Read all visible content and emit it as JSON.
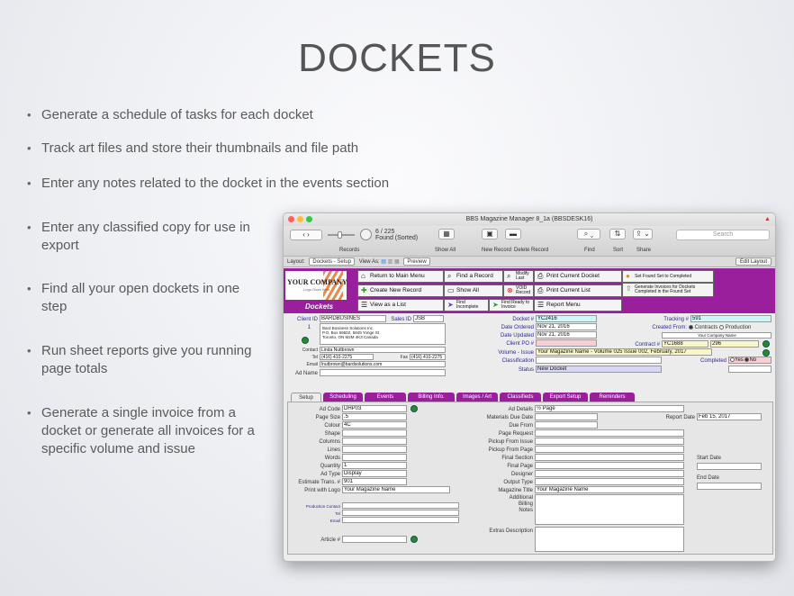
{
  "slide": {
    "title": "DOCKETS",
    "bullets": [
      "Generate a schedule of tasks for each docket",
      "Track art files and store their thumbnails and file path",
      "Enter any notes related to the docket in the events section",
      "Enter any classified copy for use in export",
      "Find all your open dockets in one step",
      "Run sheet reports give you running page totals",
      "Generate a single invoice from a docket or generate all invoices for a specific volume and issue"
    ]
  },
  "window": {
    "title": "BBS  Magazine Manager 8_1a (BBSDESK16)",
    "toolbar": {
      "record_count": "6 / 225",
      "found_label": "Found (Sorted)",
      "records_label": "Records",
      "show_all": "Show All",
      "new_record": "New Record",
      "delete_record": "Delete Record",
      "find": "Find",
      "sort": "Sort",
      "share": "Share",
      "search_placeholder": "Search"
    },
    "layoutbar": {
      "layout_label": "Layout:",
      "layout_value": "Dockets - Setup",
      "view_as": "View As:",
      "preview": "Preview",
      "edit_layout": "Edit Layout"
    }
  },
  "header": {
    "logo_text": "YOUR COMPANY",
    "logo_sub": "Logo Goes Here",
    "section": "Dockets",
    "buttons": {
      "return_main": "Return to Main Menu",
      "create_new": "Create New Record",
      "view_list": "View as a List",
      "find_record": "Find a Record",
      "show_all": "Show All",
      "find_incomplete_1": "Find",
      "find_incomplete_2": "Incomplete",
      "modify_last_1": "Modify",
      "modify_last_2": "Last",
      "void_record_1": "VOID",
      "void_record_2": "Record",
      "find_ready_1": "Find Ready to",
      "find_ready_2": "Invoice",
      "print_docket": "Print Current Docket",
      "print_list": "Print Current List",
      "report_menu": "Report Menu",
      "set_completed": "Set Found Set to Completed",
      "gen_invoices_1": "Generate Invoices for Dockets",
      "gen_invoices_2": "Completed in the Found Set"
    }
  },
  "client": {
    "client_id_label": "Client ID",
    "client_id": "BARDBUSINES",
    "sales_id_label": "Sales ID",
    "sales_id": "JSB",
    "number": "1",
    "address_1": "Bard Business Solutions Inc.",
    "address_2": "P.O. Box 69502, 5845 Yonge St",
    "address_3": "Toronto, ON  M2M 4K3  Canada",
    "contact_label": "Contact",
    "contact": "Linda Nuttbrown",
    "tel_label": "Tel",
    "tel": "(416) 410-2275",
    "fax_label": "Fax",
    "fax": "(416) 410-2275",
    "email_label": "Email",
    "email": "lnutbrown@bardsolutions.com",
    "ad_name_label": "Ad Name"
  },
  "docket": {
    "docket_label": "Docket #",
    "docket": "YC2416",
    "date_ordered_label": "Date Ordered",
    "date_ordered": "Nov 21, 2016",
    "date_updated_label": "Date Updated",
    "date_updated": "Nov 21, 2016",
    "client_po_label": "Client PO #",
    "volume_label": "Volume - Issue",
    "volume": "Your Magazine Name - Volume 025 Issue 002, February, 2017",
    "classification_label": "Classification",
    "status_label": "Status",
    "status": "New Docket",
    "tracking_label": "Tracking #",
    "tracking": "591",
    "created_from_label": "Created From:",
    "created_contracts": "Contracts",
    "created_production": "Production",
    "company_name": "Your Company Name",
    "contract_label": "Contract #",
    "contract": "YC1688",
    "contract_num": "296",
    "completed_label": "Completed",
    "yes": "Yes",
    "no": "No"
  },
  "tabs": [
    "Setup",
    "Scheduling",
    "Events",
    "Billing Info.",
    "Images / Art",
    "Classifieds",
    "Export Setup",
    "Reminders"
  ],
  "setup": {
    "ad_code_label": "Ad Code",
    "ad_code": "DHP03",
    "page_size_label": "Page Size",
    "page_size": ".5",
    "colour_label": "Colour",
    "colour": "4C",
    "shape_label": "Shape",
    "columns_label": "Columns",
    "lines_label": "Lines",
    "words_label": "Words",
    "quantity_label": "Quantity",
    "quantity": "1",
    "ad_type_label": "Ad Type",
    "ad_type": "Display",
    "estimate_label": "Estimate Trans. #",
    "estimate": "901",
    "print_logo_label": "Print with Logo",
    "print_logo": "Your Magazine Name",
    "prod_contact_label": "Production Contact",
    "tel_label": "Tel",
    "email_label": "Email",
    "article_label": "Article #",
    "ad_details_label": "Ad Details",
    "ad_details": "½ Page",
    "materials_due_label": "Materials Due Date",
    "due_from_label": "Due From",
    "page_request_label": "Page Request",
    "pickup_issue_label": "Pickup From Issue",
    "pickup_page_label": "Pickup From Page",
    "final_section_label": "Final Section",
    "final_page_label": "Final Page",
    "designer_label": "Designer",
    "output_type_label": "Output Type",
    "magazine_title_label": "Magazine Title",
    "magazine_title": "Your Magazine Name",
    "additional_label": "Additional",
    "billing_label": "Billing",
    "notes_label": "Notes",
    "extras_label": "Extras Description",
    "report_date_label": "Report Date",
    "report_date": "Feb 15, 2017",
    "start_date_label": "Start Date",
    "end_date_label": "End Date"
  }
}
